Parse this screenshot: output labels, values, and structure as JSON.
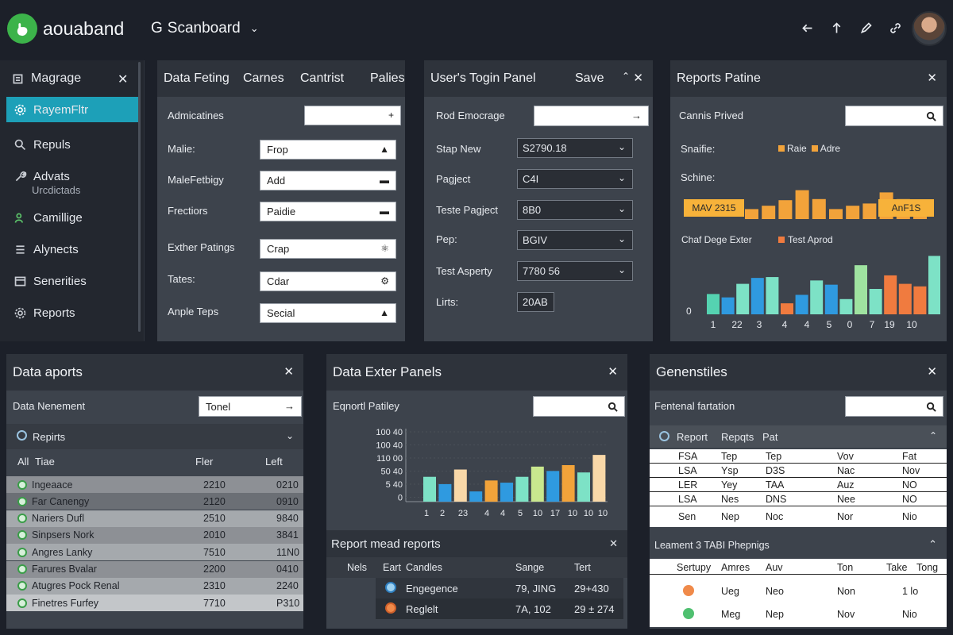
{
  "app": {
    "name": "aouaband",
    "board": "Scanboard",
    "board_prefix": "G"
  },
  "sidebar": {
    "title": "Magrage",
    "items": [
      {
        "label": "RayemFltr",
        "icon": "gear-icon",
        "active": true
      },
      {
        "label": "Repuls",
        "icon": "search-icon"
      },
      {
        "label": "Advats",
        "icon": "wrench-icon",
        "sub": "Urcdictads"
      },
      {
        "label": "Camillige",
        "icon": "users-icon"
      },
      {
        "label": "Alynects",
        "icon": "list-icon"
      },
      {
        "label": "Senerities",
        "icon": "calendar-icon"
      },
      {
        "label": "Reports",
        "icon": "gear-icon"
      }
    ]
  },
  "panel_data_feting": {
    "tabs": [
      "Data Feting",
      "Carnes",
      "Cantrist",
      "Palies"
    ],
    "top_label": "Admicatines",
    "rows": [
      {
        "label": "Malie:",
        "value": "Frop",
        "icon": "lock-icon"
      },
      {
        "label": "MaleFetbigy",
        "value": "Add",
        "icon": "list-icon"
      },
      {
        "label": "Frectiors",
        "value": "Paidie",
        "icon": "list-icon"
      },
      {
        "label": "Exther Patings",
        "value": "Crap",
        "icon": "bulb-icon"
      },
      {
        "label": "Tates:",
        "value": "Cdar",
        "icon": "gear-icon"
      },
      {
        "label": "Anple Teps",
        "value": "Secial",
        "icon": "lock-icon"
      }
    ]
  },
  "panel_login": {
    "title": "User's Togin Panel",
    "save": "Save",
    "top_label": "Rod Emocrage",
    "rows": [
      {
        "label": "Stap New",
        "value": "S2790.18"
      },
      {
        "label": "Pagject",
        "value": "C4I"
      },
      {
        "label": "Teste Pagject",
        "value": "8B0"
      },
      {
        "label": "Pep:",
        "value": "BGIV"
      },
      {
        "label": "Test Asperty",
        "value": "7780 56"
      },
      {
        "label": "Lirts:",
        "value": "20AB"
      }
    ]
  },
  "panel_reports": {
    "title": "Reports Patine",
    "search_label": "Cannis Prived",
    "chart1_label": "Snaifie:",
    "legend1": [
      {
        "label": "Raie",
        "color": "#f2a33a"
      },
      {
        "label": "Adre",
        "color": "#f2a33a"
      }
    ],
    "chart2_title": "Schine:",
    "tag_left": "MAV 2315",
    "tag_right": "AnF1S",
    "chart3_label": "Chaf Dege Exter",
    "legend2": [
      {
        "label": "Test Aprod",
        "color": "#f07b3f"
      }
    ]
  },
  "panel_data_aports": {
    "title": "Data aports",
    "top_label": "Data Nenement",
    "top_value": "Tonel",
    "group": "Repirts",
    "columns": [
      "All",
      "Tiae",
      "Fler",
      "Left"
    ],
    "rows": [
      {
        "name": "Ingeaace",
        "v1": "2210",
        "v2": "0210"
      },
      {
        "name": "Far Canengy",
        "v1": "2120",
        "v2": "0910"
      },
      {
        "name": "Nariers  Dufl",
        "v1": "2510",
        "v2": "9840"
      },
      {
        "name": "Sinpsers  Nork",
        "v1": "2010",
        "v2": "3841"
      },
      {
        "name": "Angres  Lanky",
        "v1": "7510",
        "v2": "11N0"
      },
      {
        "name": "Farures  Bvalar",
        "v1": "2200",
        "v2": "0410"
      },
      {
        "name": "Atugres  Pock Renal",
        "v1": "2310",
        "v2": "2240"
      },
      {
        "name": "Finetres  Furfey",
        "v1": "7710",
        "v2": "P310"
      }
    ]
  },
  "panel_exter": {
    "title": "Data Exter Panels",
    "search_label": "Eqnortl Patiley",
    "sub_title": "Report mead reports",
    "sub_cols": [
      "Nels",
      "Eart",
      "Candles",
      "Sange",
      "Tert"
    ],
    "sub_rows": [
      {
        "name": "Engegence",
        "v1": "79, JING",
        "v2": "29+430"
      },
      {
        "name": "Reglelt",
        "v1": "7A, 102",
        "v2": "29 ± 274"
      }
    ]
  },
  "panel_gener": {
    "title": "Genenstiles",
    "search_label": "Fentenal fartation",
    "group_cols": [
      "Report",
      "Repqts",
      "Pat"
    ],
    "table1": [
      [
        "FSA",
        "Tep",
        "Tep",
        "Vov",
        "Fat"
      ],
      [
        "LSA",
        "Ysp",
        "D3S",
        "Nac",
        "Nov"
      ],
      [
        "LER",
        "Yey",
        "TAA",
        "Auz",
        "NO"
      ],
      [
        "LSA",
        "Nes",
        "DNS",
        "Nee",
        "NO"
      ],
      [
        "Sen",
        "Nep",
        "Noc",
        "Nor",
        "Nio"
      ]
    ],
    "sub_title": "Leament 3 TABI Phepnigs",
    "table2_cols": [
      "Sertupy",
      "Amres",
      "Auv",
      "Ton",
      "Take",
      "Tong"
    ],
    "table2": [
      [
        "Ueg",
        "Neo",
        "Non",
        "1 lo"
      ],
      [
        "Meg",
        "Nep",
        "Nov",
        "Nio"
      ]
    ]
  },
  "chart_data": [
    {
      "type": "bar",
      "title": "Schine:",
      "values": [
        18,
        24,
        34,
        52,
        36,
        18,
        24,
        28,
        48,
        36,
        30
      ],
      "color": "#f2a33a",
      "ylim": [
        0,
        60
      ]
    },
    {
      "type": "bar",
      "title": "Chaf Dege Exter",
      "categories": [
        "1",
        "22",
        "3",
        "4",
        "4",
        "5",
        "0",
        "7",
        "19",
        "10"
      ],
      "values": [
        24,
        20,
        36,
        43,
        44,
        13,
        23,
        40,
        35,
        18,
        58,
        30,
        46,
        36,
        33,
        69
      ],
      "colors": [
        "#55d3b1",
        "#2f9ae0",
        "#7de2c6",
        "#2f9ae0",
        "#7de2c6",
        "#f07b3f",
        "#2f9ae0",
        "#7de2c6",
        "#2f9ae0",
        "#7de2c6",
        "#9fe3a0",
        "#7de2c6",
        "#f07b3f",
        "#f07b3f",
        "#f07b3f",
        "#7de2c6"
      ],
      "y_tick": "0",
      "ylim": [
        0,
        75
      ]
    },
    {
      "type": "bar",
      "title": "Eqnortl Patiley",
      "categories": [
        "1",
        "2",
        "23",
        "4",
        "4",
        "5",
        "10",
        "17",
        "10",
        "10",
        "10"
      ],
      "values": [
        34,
        24,
        44,
        14,
        29,
        26,
        34,
        48,
        42,
        50,
        40,
        64
      ],
      "colors": [
        "#7de2c6",
        "#2f9ae0",
        "#f9d8a8",
        "#2f9ae0",
        "#f2a33a",
        "#2f9ae0",
        "#7de2c6",
        "#c9e78e",
        "#2f9ae0",
        "#f2a33a",
        "#7de2c6",
        "#f9d8a8"
      ],
      "yticks": [
        "100 40",
        "100 40",
        "110 00",
        "50 40",
        "5 40",
        "0"
      ],
      "ylim": [
        0,
        100
      ]
    }
  ]
}
